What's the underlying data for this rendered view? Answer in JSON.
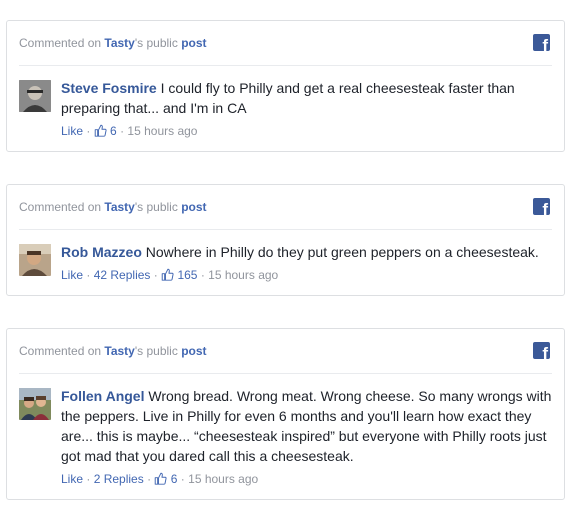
{
  "cards": [
    {
      "header": {
        "prefix": "Commented on",
        "page_name": "Tasty",
        "possessive": "'s public",
        "post_link": "post"
      },
      "comment": {
        "author": "Steve Fosmire",
        "text": "I could fly to Philly and get a real cheesesteak faster than preparing that... and I'm in CA",
        "like_label": "Like",
        "replies_label": "",
        "like_count": "6",
        "time": "15 hours ago"
      }
    },
    {
      "header": {
        "prefix": "Commented on",
        "page_name": "Tasty",
        "possessive": "'s public",
        "post_link": "post"
      },
      "comment": {
        "author": "Rob Mazzeo",
        "text": "Nowhere in Philly do they put green peppers on a cheesesteak.",
        "like_label": "Like",
        "replies_label": "42 Replies",
        "like_count": "165",
        "time": "15 hours ago"
      }
    },
    {
      "header": {
        "prefix": "Commented on",
        "page_name": "Tasty",
        "possessive": "'s public",
        "post_link": "post"
      },
      "comment": {
        "author": "Follen Angel",
        "text": "Wrong bread. Wrong meat. Wrong cheese. So many wrongs with the peppers. Live in Philly for even 6 months and you'll learn how exact they are... this is maybe... “cheesesteak inspired” but everyone with Philly roots just got mad that you dared call this a cheesesteak.",
        "like_label": "Like",
        "replies_label": "2 Replies",
        "like_count": "6",
        "time": "15 hours ago"
      }
    }
  ],
  "colors": {
    "link": "#4267b2",
    "author": "#365899",
    "meta": "#90949c",
    "facebook_blue": "#3b5998"
  },
  "icons": {
    "facebook": "facebook-icon",
    "like": "thumbs-up-icon"
  }
}
